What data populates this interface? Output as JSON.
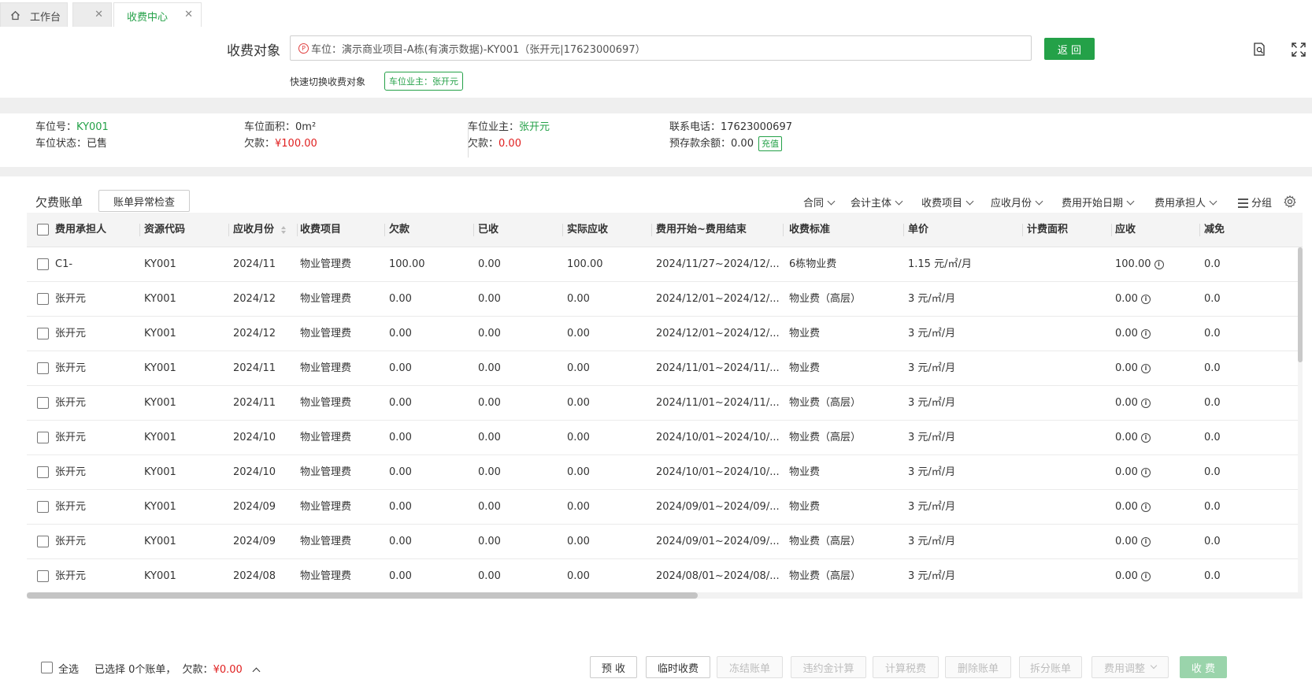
{
  "tabs": [
    {
      "label": "工作台",
      "active": false
    },
    {
      "label": "",
      "active": false
    },
    {
      "label": "收费中心",
      "active": true
    }
  ],
  "header": {
    "target_label": "收费对象",
    "target_value": "车位：演示商业项目-A栋(有演示数据)-KY001（张开元|17623000697）",
    "back_label": "返 回",
    "quick_switch_label": "快速切换收费对象",
    "quick_switch_tag": "车位业主：张开元"
  },
  "info": {
    "space_no_label": "车位号：",
    "space_no": "KY001",
    "space_status_label": "车位状态：",
    "space_status": "已售",
    "area_label": "车位面积：",
    "area": "0m²",
    "arrears_label": "欠款：",
    "arrears": "¥100.00",
    "owner_label": "车位业主：",
    "owner": "张开元",
    "owner_arrears_label": "欠款：",
    "owner_arrears": "0.00",
    "phone_label": "联系电话：",
    "phone": "17623000697",
    "deposit_label": "预存款余额：",
    "deposit": "0.00",
    "recharge_label": "充值"
  },
  "bills": {
    "title": "欠费账单",
    "check_button": "账单异常检查",
    "filters": [
      "合同",
      "会计主体",
      "收费项目",
      "应收月份",
      "费用开始日期",
      "费用承担人"
    ],
    "group_label": "分组",
    "columns": [
      "费用承担人",
      "资源代码",
      "应收月份",
      "收费项目",
      "欠款",
      "已收",
      "实际应收",
      "费用开始~费用结束",
      "收费标准",
      "单价",
      "计费面积",
      "应收",
      "减免"
    ],
    "rows": [
      {
        "payer": "C1-",
        "code": "KY001",
        "month": "2024/11",
        "item": "物业管理费",
        "owed": "100.00",
        "paid": "0.00",
        "actual": "100.00",
        "period": "2024/11/27~2024/12/...",
        "standard": "6栋物业费",
        "price": "1.15 元/㎡/月",
        "area": "",
        "receivable": "100.00",
        "discount": "0.0"
      },
      {
        "payer": "张开元",
        "code": "KY001",
        "month": "2024/12",
        "item": "物业管理费",
        "owed": "0.00",
        "paid": "0.00",
        "actual": "0.00",
        "period": "2024/12/01~2024/12/...",
        "standard": "物业费（高层）",
        "price": "3 元/㎡/月",
        "area": "",
        "receivable": "0.00",
        "discount": "0.0"
      },
      {
        "payer": "张开元",
        "code": "KY001",
        "month": "2024/12",
        "item": "物业管理费",
        "owed": "0.00",
        "paid": "0.00",
        "actual": "0.00",
        "period": "2024/12/01~2024/12/...",
        "standard": "物业费",
        "price": "3 元/㎡/月",
        "area": "",
        "receivable": "0.00",
        "discount": "0.0"
      },
      {
        "payer": "张开元",
        "code": "KY001",
        "month": "2024/11",
        "item": "物业管理费",
        "owed": "0.00",
        "paid": "0.00",
        "actual": "0.00",
        "period": "2024/11/01~2024/11/...",
        "standard": "物业费",
        "price": "3 元/㎡/月",
        "area": "",
        "receivable": "0.00",
        "discount": "0.0"
      },
      {
        "payer": "张开元",
        "code": "KY001",
        "month": "2024/11",
        "item": "物业管理费",
        "owed": "0.00",
        "paid": "0.00",
        "actual": "0.00",
        "period": "2024/11/01~2024/11/...",
        "standard": "物业费（高层）",
        "price": "3 元/㎡/月",
        "area": "",
        "receivable": "0.00",
        "discount": "0.0"
      },
      {
        "payer": "张开元",
        "code": "KY001",
        "month": "2024/10",
        "item": "物业管理费",
        "owed": "0.00",
        "paid": "0.00",
        "actual": "0.00",
        "period": "2024/10/01~2024/10/...",
        "standard": "物业费（高层）",
        "price": "3 元/㎡/月",
        "area": "",
        "receivable": "0.00",
        "discount": "0.0"
      },
      {
        "payer": "张开元",
        "code": "KY001",
        "month": "2024/10",
        "item": "物业管理费",
        "owed": "0.00",
        "paid": "0.00",
        "actual": "0.00",
        "period": "2024/10/01~2024/10/...",
        "standard": "物业费",
        "price": "3 元/㎡/月",
        "area": "",
        "receivable": "0.00",
        "discount": "0.0"
      },
      {
        "payer": "张开元",
        "code": "KY001",
        "month": "2024/09",
        "item": "物业管理费",
        "owed": "0.00",
        "paid": "0.00",
        "actual": "0.00",
        "period": "2024/09/01~2024/09/...",
        "standard": "物业费",
        "price": "3 元/㎡/月",
        "area": "",
        "receivable": "0.00",
        "discount": "0.0"
      },
      {
        "payer": "张开元",
        "code": "KY001",
        "month": "2024/09",
        "item": "物业管理费",
        "owed": "0.00",
        "paid": "0.00",
        "actual": "0.00",
        "period": "2024/09/01~2024/09/...",
        "standard": "物业费（高层）",
        "price": "3 元/㎡/月",
        "area": "",
        "receivable": "0.00",
        "discount": "0.0"
      },
      {
        "payer": "张开元",
        "code": "KY001",
        "month": "2024/08",
        "item": "物业管理费",
        "owed": "0.00",
        "paid": "0.00",
        "actual": "0.00",
        "period": "2024/08/01~2024/08/...",
        "standard": "物业费（高层）",
        "price": "3 元/㎡/月",
        "area": "",
        "receivable": "0.00",
        "discount": "0.0"
      }
    ]
  },
  "footer": {
    "select_all": "全选",
    "selected_text": "已选择 0个账单，",
    "owed_label": "欠款：",
    "owed_value": "¥0.00",
    "buttons": [
      {
        "label": "预 收",
        "disabled": false
      },
      {
        "label": "临时收费",
        "disabled": false
      },
      {
        "label": "冻结账单",
        "disabled": true
      },
      {
        "label": "违约金计算",
        "disabled": true
      },
      {
        "label": "计算税费",
        "disabled": true
      },
      {
        "label": "删除账单",
        "disabled": true
      },
      {
        "label": "拆分账单",
        "disabled": true
      },
      {
        "label": "费用调整",
        "disabled": true
      },
      {
        "label": "收 费",
        "disabled": false
      }
    ]
  },
  "colors": {
    "accent": "#24a148",
    "danger": "#e02020"
  },
  "icons": [
    "home-icon",
    "close-icon",
    "document-search-icon",
    "fullscreen-icon",
    "chevron-down-icon",
    "group-list-icon",
    "gear-icon",
    "info-icon",
    "chevron-up-icon",
    "sort-icon"
  ]
}
